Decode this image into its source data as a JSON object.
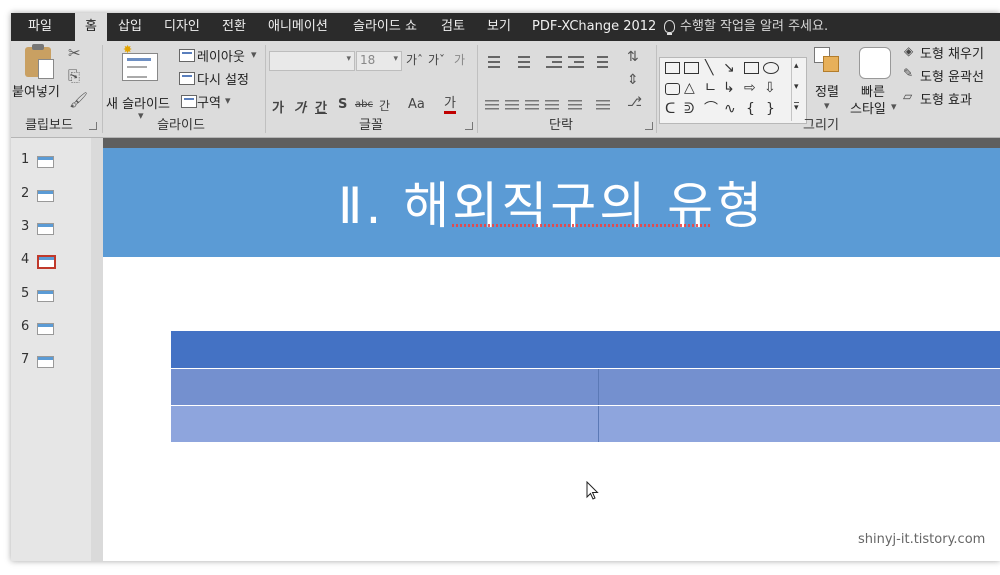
{
  "menubar": {
    "tabs": [
      {
        "label": "파일"
      },
      {
        "label": "홈"
      },
      {
        "label": "삽입"
      },
      {
        "label": "디자인"
      },
      {
        "label": "전환"
      },
      {
        "label": "애니메이션"
      },
      {
        "label": "슬라이드 쇼"
      },
      {
        "label": "검토"
      },
      {
        "label": "보기"
      },
      {
        "label": "PDF-XChange 2012"
      }
    ],
    "active_tab": "홈",
    "tell_me": "수행할 작업을 알려 주세요."
  },
  "ribbon": {
    "clipboard": {
      "group_label": "클립보드",
      "paste_label": "붙여넣기"
    },
    "slides": {
      "group_label": "슬라이드",
      "new_slide_label": "새 슬라이드",
      "layout_label": "레이아웃",
      "reset_label": "다시 설정",
      "section_label": "구역"
    },
    "font": {
      "group_label": "글꼴",
      "font_name": "",
      "font_size": "18",
      "bold": "가",
      "italic": "가",
      "underline": "간",
      "shadow": "S",
      "strike": "abc",
      "spacing": "간",
      "case": "Aa",
      "color": "가"
    },
    "paragraph": {
      "group_label": "단락"
    },
    "drawing": {
      "group_label": "그리기",
      "arrange_label": "정렬",
      "quick_style_label_1": "빠른",
      "quick_style_label_2": "스타일",
      "shape_fill": "도형 채우기",
      "shape_outline": "도형 윤곽선",
      "shape_effects": "도형 효과"
    }
  },
  "thumbnails": {
    "slides": [
      {
        "number": "1"
      },
      {
        "number": "2"
      },
      {
        "number": "3"
      },
      {
        "number": "4"
      },
      {
        "number": "5"
      },
      {
        "number": "6"
      },
      {
        "number": "7"
      }
    ],
    "selected": "4"
  },
  "slide": {
    "title": "Ⅱ. 해외직구의 유형",
    "title_band_color": "#5b9bd5",
    "table_header_color": "#4472c4",
    "table_row_colors": [
      "#7490cf",
      "#8ea5dd"
    ]
  },
  "watermark": "shinyj-it.tistory.com"
}
